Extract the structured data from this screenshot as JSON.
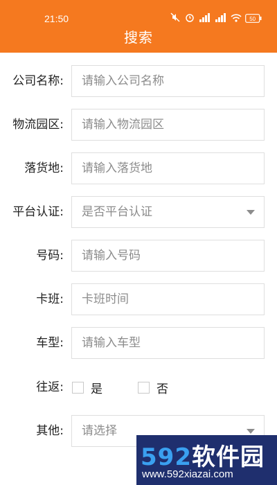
{
  "status_bar": {
    "time": "21:50",
    "icons": [
      "mute-icon",
      "alarm-icon",
      "signal-icon",
      "signal-icon",
      "wifi-icon",
      "battery-icon"
    ],
    "battery": "50"
  },
  "header": {
    "title": "搜索",
    "background": "#f5791f"
  },
  "form": {
    "company": {
      "label": "公司名称:",
      "placeholder": "请输入公司名称"
    },
    "park": {
      "label": "物流园区:",
      "placeholder": "请输入物流园区"
    },
    "destination": {
      "label": "落货地:",
      "placeholder": "请输入落货地"
    },
    "certified": {
      "label": "平台认证:",
      "value": "是否平台认证"
    },
    "number": {
      "label": "号码:",
      "placeholder": "请输入号码"
    },
    "shift": {
      "label": "卡班:",
      "placeholder": "卡班时间"
    },
    "vehicle_type": {
      "label": "车型:",
      "placeholder": "请输入车型"
    },
    "round_trip": {
      "label": "往返:",
      "yes": "是",
      "no": "否"
    },
    "other": {
      "label": "其他:",
      "value": "请选择"
    }
  },
  "watermark": {
    "brand_number": "592",
    "brand_text": "软件园",
    "url": "www.592xiazai.com"
  }
}
